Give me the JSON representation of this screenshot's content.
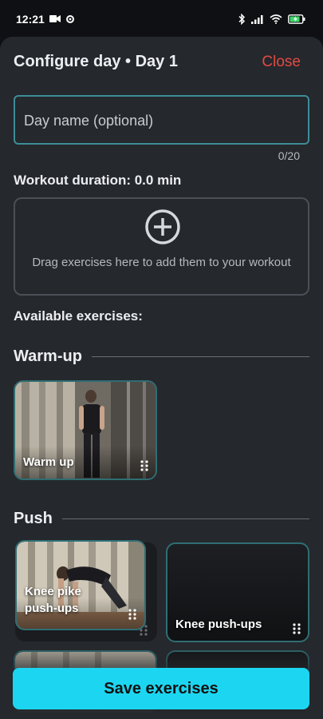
{
  "status_bar": {
    "time": "12:21"
  },
  "header": {
    "title": "Configure day • Day 1",
    "close_label": "Close"
  },
  "day_name": {
    "placeholder": "Day name (optional)",
    "counter": "0/20"
  },
  "duration": {
    "text": "Workout duration: 0.0 min"
  },
  "drop_zone": {
    "hint": "Drag exercises here to add them to your workout"
  },
  "available_label": "Available exercises:",
  "sections": [
    {
      "title": "Warm-up",
      "exercises": [
        {
          "label": "Warm up"
        }
      ]
    },
    {
      "title": "Push",
      "exercises": [
        {
          "label": "Knee pike push-ups"
        },
        {
          "label": "Knee push-ups"
        }
      ]
    }
  ],
  "save_label": "Save exercises",
  "colors": {
    "accent": "#1cd6f1",
    "close": "#e24b44",
    "card_border": "#2f6e73",
    "field_border": "#3d8d97"
  }
}
